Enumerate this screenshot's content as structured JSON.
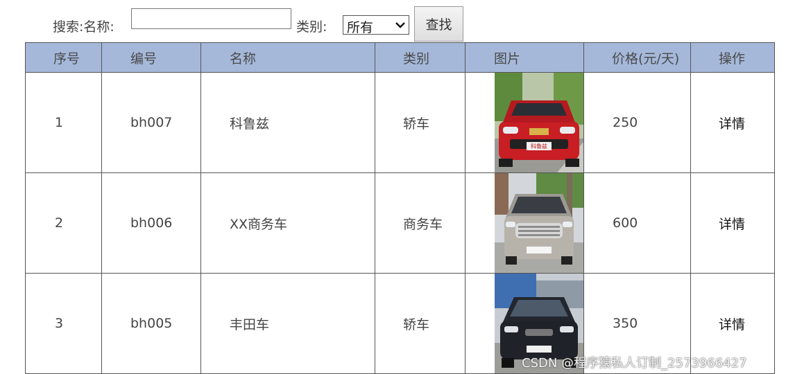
{
  "search": {
    "label": "搜索:名称:",
    "name_value": "",
    "type_label": "类别:",
    "type_selected": "所有",
    "button_label": "查找"
  },
  "table": {
    "headers": [
      "序号",
      "编号",
      "名称",
      "类别",
      "图片",
      "价格(元/天)",
      "操作"
    ],
    "rows": [
      {
        "index": "1",
        "code": "bh007",
        "name": "科鲁兹",
        "type": "轿车",
        "image": "red-sedan-photo",
        "price": "250",
        "action": "详情"
      },
      {
        "index": "2",
        "code": "bh006",
        "name": "XX商务车",
        "type": "商务车",
        "image": "silver-mpv-photo",
        "price": "600",
        "action": "详情"
      },
      {
        "index": "3",
        "code": "bh005",
        "name": "丰田车",
        "type": "轿车",
        "image": "dark-sedan-photo",
        "price": "350",
        "action": "详情"
      }
    ]
  },
  "colors": {
    "header_bg": "#a5b8da",
    "border": "#555555"
  },
  "watermark": "CSDN @程序猿私人订制_2573966427"
}
